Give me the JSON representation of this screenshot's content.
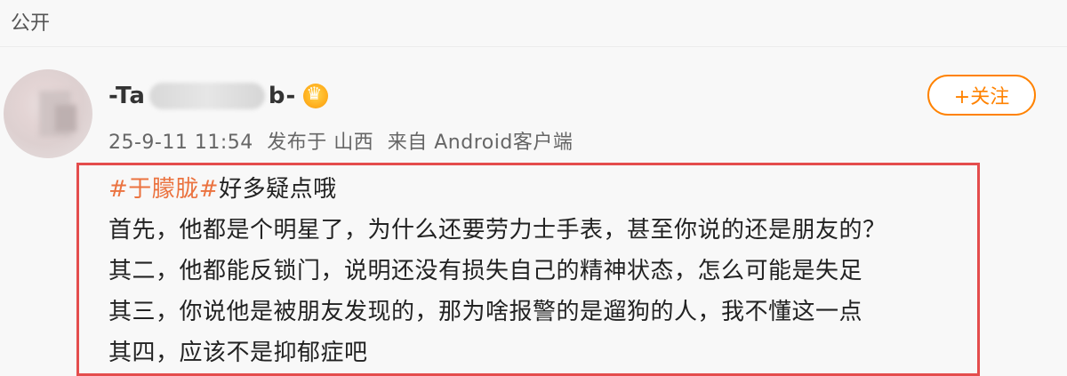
{
  "visibility_label": "公开",
  "user": {
    "name_prefix": "-Ta",
    "name_suffix": "b-",
    "badge_icon": "crown-icon"
  },
  "meta": {
    "time": "25-9-11 11:54",
    "published_at_label": "发布于 山西",
    "source_label": "来自 Android客户端"
  },
  "follow": {
    "label": "+关注",
    "color": "#ff8200"
  },
  "post": {
    "hashtag": "#于朦胧#",
    "line1_rest": "好多疑点哦",
    "lines": [
      "首先，他都是个明星了，为什么还要劳力士手表，甚至你说的还是朋友的？",
      "其二，他都能反锁门，说明还没有损失自己的精神状态，怎么可能是失足",
      "其三，你说他是被朋友发现的，那为啥报警的是遛狗的人，我不懂这一点",
      "其四，应该不是抑郁症吧"
    ],
    "hashtag_color": "#eb7340",
    "highlight_border_color": "#e44d4d"
  }
}
